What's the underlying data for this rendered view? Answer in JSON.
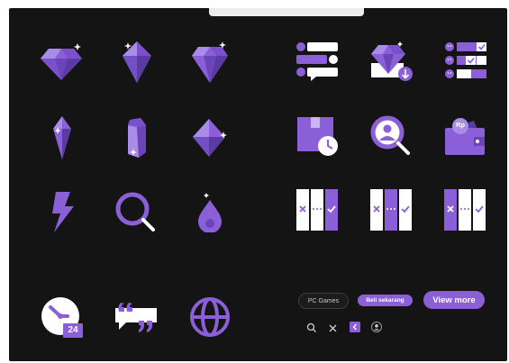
{
  "colors": {
    "background": "#141414",
    "accent": "#8b5fd8",
    "accent_dark": "#6a44b8",
    "accent_light": "#a98be8",
    "white": "#ffffff"
  },
  "icons": {
    "row1": [
      "diamond-icon",
      "gem-icon",
      "crystal-icon",
      "chat-list-icon",
      "gem-download-icon",
      "user-checklist-icon"
    ],
    "row2": [
      "crystal-shard-icon",
      "crystal-prism-icon",
      "rhombus-gem-icon",
      "package-clock-icon",
      "search-user-icon",
      "wallet-icon"
    ],
    "row3": [
      "lightning-icon",
      "search-icon",
      "water-drop-icon",
      "compare-panels-icon",
      "compare-panels-icon",
      "compare-panels-icon"
    ],
    "row4": [
      "clock-badge-icon",
      "quote-icon",
      "globe-icon"
    ]
  },
  "badges": {
    "clock_number": "24",
    "wallet_currency": "Rp"
  },
  "buttons": {
    "pc_games": "PC Games",
    "beli_sekarang": "Beli sekarang",
    "view_more": "View more"
  },
  "mini_icons": [
    "search-icon",
    "close-icon",
    "chevron-left-icon",
    "user-icon"
  ]
}
